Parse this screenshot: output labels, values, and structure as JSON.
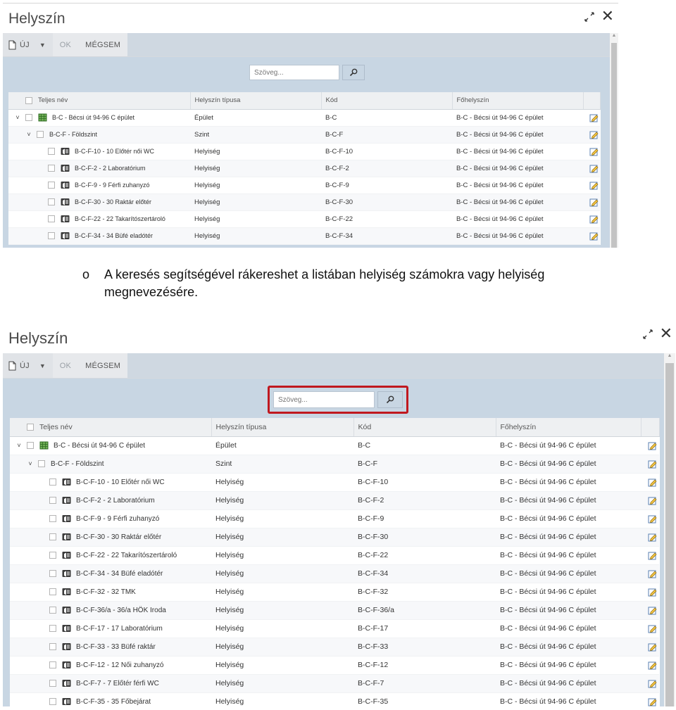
{
  "dialog": {
    "title": "Helyszín"
  },
  "toolbar": {
    "new_label": "ÚJ",
    "ok_label": "OK",
    "cancel_label": "MÉGSEM"
  },
  "search": {
    "placeholder": "Szöveg..."
  },
  "columns": [
    "Teljes név",
    "Helyszín típusa",
    "Kód",
    "Főhelyszín"
  ],
  "rows": [
    {
      "name": "B-C - Bécsi út 94-96 C épület",
      "type": "Épület",
      "code": "B-C",
      "parent": "B-C - Bécsi út 94-96 C épület",
      "level": 0,
      "icon": "building-icon"
    },
    {
      "name": "B-C-F - Földszint",
      "type": "Szint",
      "code": "B-C-F",
      "parent": "B-C - Bécsi út 94-96 C épület",
      "level": 1,
      "icon": "none"
    },
    {
      "name": "B-C-F-10 - 10 Előtér női WC",
      "type": "Helyiség",
      "code": "B-C-F-10",
      "parent": "B-C - Bécsi út 94-96 C épület",
      "level": 2,
      "icon": "room-icon"
    },
    {
      "name": "B-C-F-2 - 2 Laboratórium",
      "type": "Helyiség",
      "code": "B-C-F-2",
      "parent": "B-C - Bécsi út 94-96 C épület",
      "level": 2,
      "icon": "room-icon"
    },
    {
      "name": "B-C-F-9 - 9 Férfi zuhanyzó",
      "type": "Helyiség",
      "code": "B-C-F-9",
      "parent": "B-C - Bécsi út 94-96 C épület",
      "level": 2,
      "icon": "room-icon"
    },
    {
      "name": "B-C-F-30 - 30 Raktár előtér",
      "type": "Helyiség",
      "code": "B-C-F-30",
      "parent": "B-C - Bécsi út 94-96 C épület",
      "level": 2,
      "icon": "room-icon"
    },
    {
      "name": "B-C-F-22 - 22 Takarítószertároló",
      "type": "Helyiség",
      "code": "B-C-F-22",
      "parent": "B-C - Bécsi út 94-96 C épület",
      "level": 2,
      "icon": "room-icon"
    },
    {
      "name": "B-C-F-34 - 34 Büfé eladótér",
      "type": "Helyiség",
      "code": "B-C-F-34",
      "parent": "B-C - Bécsi út 94-96 C épület",
      "level": 2,
      "icon": "room-icon"
    },
    {
      "name": "B-C-F-32 - 32 TMK",
      "type": "Helyiség",
      "code": "B-C-F-32",
      "parent": "B-C - Bécsi út 94-96 C épület",
      "level": 2,
      "icon": "room-icon"
    },
    {
      "name": "B-C-F-36/a - 36/a HÖK Iroda",
      "type": "Helyiség",
      "code": "B-C-F-36/a",
      "parent": "B-C - Bécsi út 94-96 C épület",
      "level": 2,
      "icon": "room-icon"
    },
    {
      "name": "B-C-F-17 - 17 Laboratórium",
      "type": "Helyiség",
      "code": "B-C-F-17",
      "parent": "B-C - Bécsi út 94-96 C épület",
      "level": 2,
      "icon": "room-icon"
    },
    {
      "name": "B-C-F-33 - 33 Büfé raktár",
      "type": "Helyiség",
      "code": "B-C-F-33",
      "parent": "B-C - Bécsi út 94-96 C épület",
      "level": 2,
      "icon": "room-icon"
    },
    {
      "name": "B-C-F-12 - 12 Női zuhanyzó",
      "type": "Helyiség",
      "code": "B-C-F-12",
      "parent": "B-C - Bécsi út 94-96 C épület",
      "level": 2,
      "icon": "room-icon"
    },
    {
      "name": "B-C-F-7 - 7 Előtér férfi WC",
      "type": "Helyiség",
      "code": "B-C-F-7",
      "parent": "B-C - Bécsi út 94-96 C épület",
      "level": 2,
      "icon": "room-icon"
    },
    {
      "name": "B-C-F-35 - 35 Főbejárat",
      "type": "Helyiség",
      "code": "B-C-F-35",
      "parent": "B-C - Bécsi út 94-96 C épület",
      "level": 2,
      "icon": "room-icon"
    }
  ],
  "screenshot_1_visible_rows": 8,
  "bullet": {
    "marker": "o",
    "text": "A keresés segítségével rákereshet a listában helyiség számokra vagy helyiség megnevezésére."
  },
  "colors": {
    "highlight_box": "#c0181f",
    "toolbar_bg": "#e7e9ec",
    "search_band": "#c8d6e3",
    "building_icon": "#3a7d2c"
  }
}
